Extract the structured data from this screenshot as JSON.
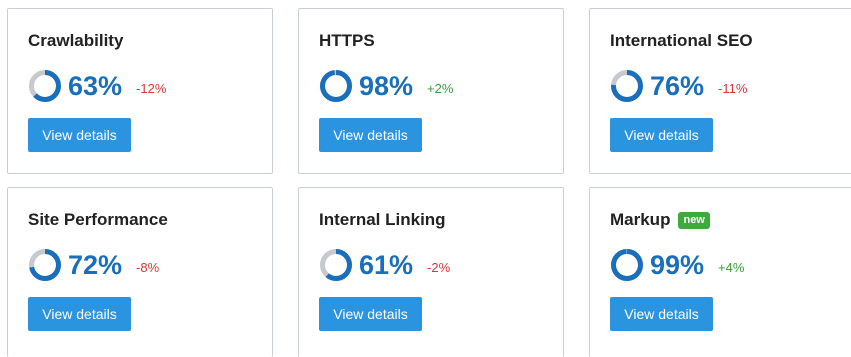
{
  "colors": {
    "accent": "#1a6fbd",
    "button": "#2a94e0",
    "track": "#c6c9cd",
    "negative": "#d2383a",
    "positive": "#3b9a3b",
    "badge": "#3daa3d"
  },
  "cards": [
    {
      "title": "Crawlability",
      "percent_value": 63,
      "percent": "63%",
      "delta": "-12%",
      "trend": "negative",
      "button": "View details"
    },
    {
      "title": "HTTPS",
      "percent_value": 98,
      "percent": "98%",
      "delta": "+2%",
      "trend": "positive",
      "button": "View details"
    },
    {
      "title": "International SEO",
      "percent_value": 76,
      "percent": "76%",
      "delta": "-11%",
      "trend": "negative",
      "button": "View details"
    },
    {
      "title": "Site Performance",
      "percent_value": 72,
      "percent": "72%",
      "delta": "-8%",
      "trend": "negative",
      "button": "View details"
    },
    {
      "title": "Internal Linking",
      "percent_value": 61,
      "percent": "61%",
      "delta": "-2%",
      "trend": "negative",
      "button": "View details"
    },
    {
      "title": "Markup",
      "badge": "new",
      "percent_value": 99,
      "percent": "99%",
      "delta": "+4%",
      "trend": "positive",
      "button": "View details"
    }
  ]
}
